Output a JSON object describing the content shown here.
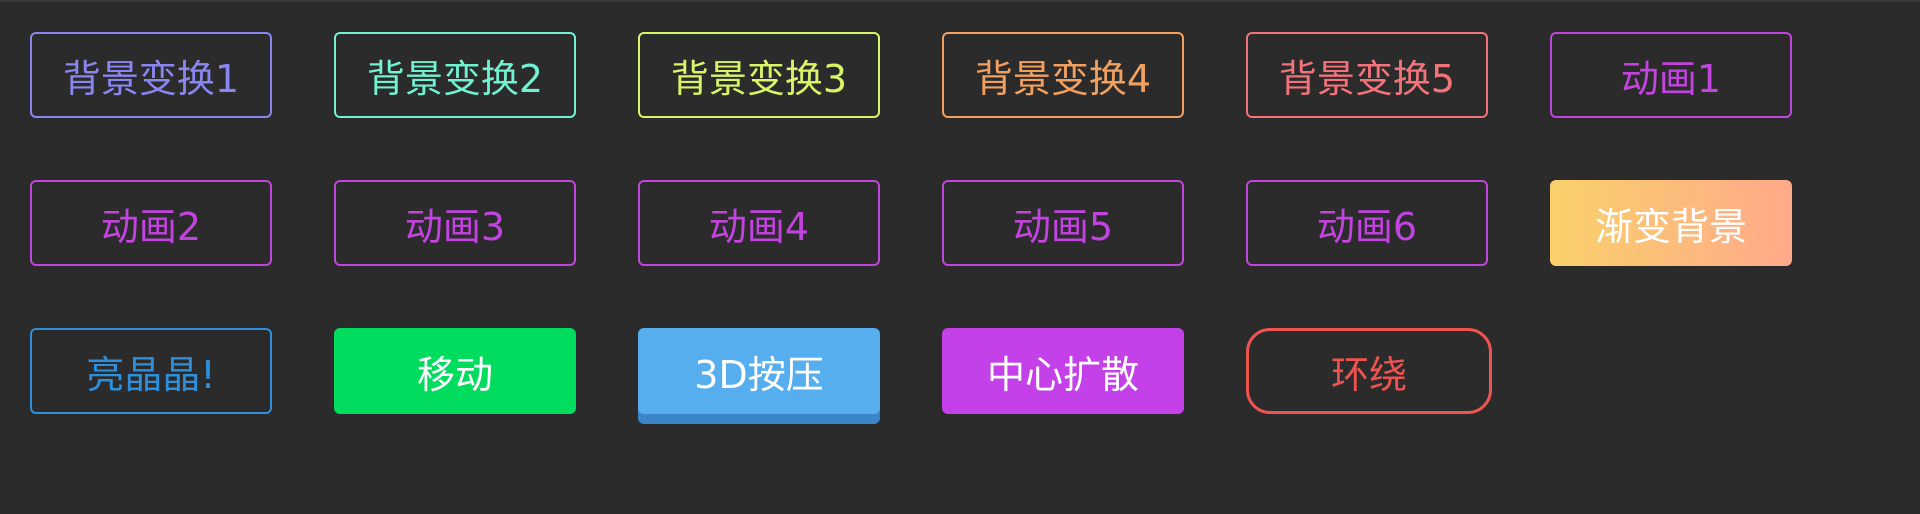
{
  "buttons": {
    "row1": [
      {
        "label": "背景变换1",
        "color": "#8a86f0"
      },
      {
        "label": "背景变换2",
        "color": "#72f0d2"
      },
      {
        "label": "背景变换3",
        "color": "#d8f56a"
      },
      {
        "label": "背景变换4",
        "color": "#f2a060"
      },
      {
        "label": "背景变换5",
        "color": "#f2737a"
      },
      {
        "label": "动画1",
        "color": "#c244de"
      }
    ],
    "row2": [
      {
        "label": "动画2",
        "color": "#c244de"
      },
      {
        "label": "动画3",
        "color": "#c244de"
      },
      {
        "label": "动画4",
        "color": "#c244de"
      },
      {
        "label": "动画5",
        "color": "#c244de"
      },
      {
        "label": "动画6",
        "color": "#c244de"
      },
      {
        "label": "渐变背景",
        "color_start": "#f9d16b",
        "color_end": "#ffa98a"
      }
    ],
    "row3": [
      {
        "label": "亮晶晶!",
        "color": "#2e8fdb"
      },
      {
        "label": "移动",
        "color": "#00dc5e"
      },
      {
        "label": "3D按压",
        "color": "#56aeee",
        "shadow_color": "#3b86c9"
      },
      {
        "label": "中心扩散",
        "color": "#c440e8"
      },
      {
        "label": "环绕",
        "color": "#ef5350"
      }
    ]
  },
  "theme": {
    "background": "#2b2b2b",
    "text_on_solid": "#ffffff"
  }
}
